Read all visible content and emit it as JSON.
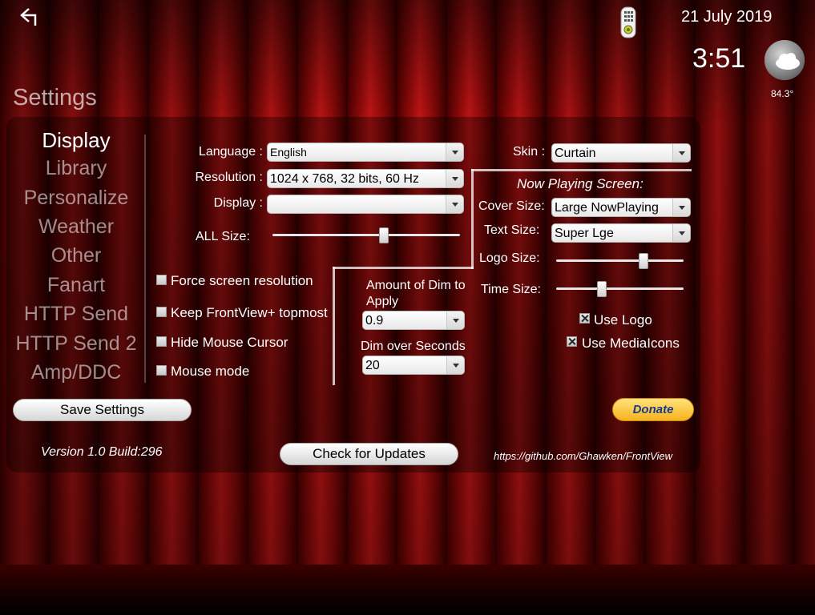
{
  "topbar": {
    "date": "21 July 2019",
    "time": "3:51",
    "temperature": "84.3°"
  },
  "page_title": "Settings",
  "categories": [
    "Display",
    "Library",
    "Personalize",
    "Weather",
    "Other",
    "Fanart",
    "HTTP Send",
    "HTTP Send 2",
    "Amp/DDC"
  ],
  "active_category": "Display",
  "display": {
    "language_label": "Language :",
    "language_value": "English",
    "resolution_label": "Resolution :",
    "resolution_value": "1024 x 768, 32 bits, 60 Hz",
    "display_label": "Display :",
    "display_value": "",
    "all_size_label": "ALL Size:",
    "all_size_level": 0.6,
    "checkboxes": [
      {
        "label": "Force screen resolution",
        "checked": false
      },
      {
        "label": "Keep FrontView+ topmost",
        "checked": false
      },
      {
        "label": "Hide Mouse Cursor",
        "checked": false
      },
      {
        "label": "Mouse mode",
        "checked": false
      }
    ],
    "dim_amount_label": "Amount of Dim to Apply",
    "dim_amount_value": "0.9",
    "dim_seconds_label": "Dim over Seconds",
    "dim_seconds_value": "20"
  },
  "skin": {
    "label": "Skin :",
    "value": "Curtain",
    "now_playing_heading": "Now Playing Screen:",
    "cover_size_label": "Cover Size:",
    "cover_size_value": "Large NowPlaying",
    "text_size_label": "Text Size:",
    "text_size_value": "Super Lge",
    "logo_size_label": "Logo Size:",
    "logo_size_level": 0.7,
    "time_size_label": "Time Size:",
    "time_size_level": 0.35,
    "use_logo_label": "Use Logo",
    "use_logo_checked": true,
    "use_mediaicons_label": "Use MediaIcons",
    "use_mediaicons_checked": true
  },
  "footer": {
    "save_label": "Save Settings",
    "version": "Version 1.0 Build:296",
    "check_updates_label": "Check for Updates",
    "url": "https://github.com/Ghawken/FrontView",
    "donate_label": "Donate"
  },
  "colors": {
    "curtain": "#b00a0a",
    "panel": "#000000",
    "donate": "#f7b21e"
  }
}
